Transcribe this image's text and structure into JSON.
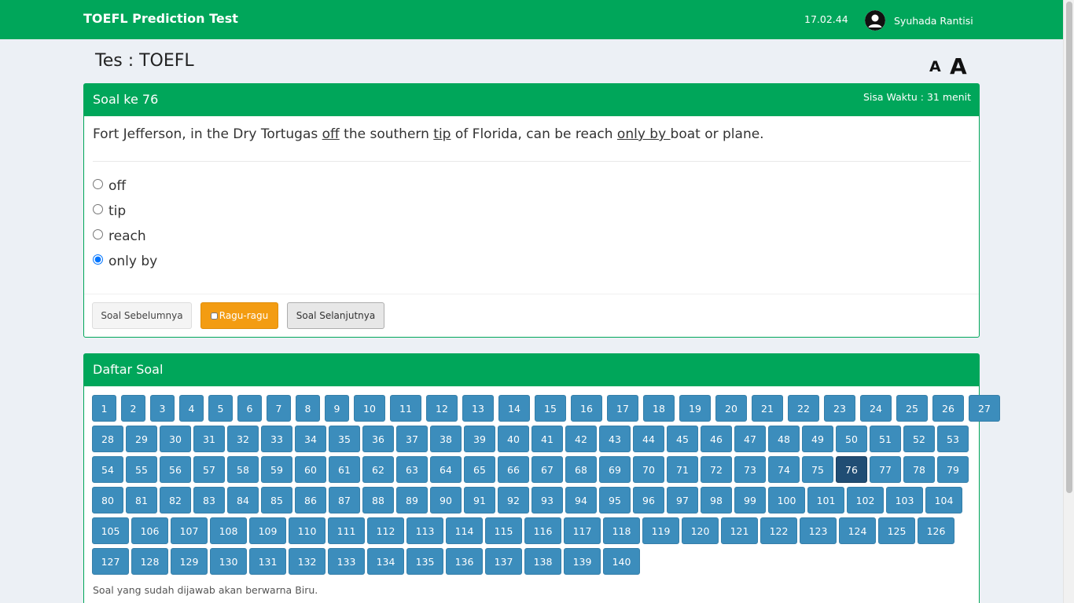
{
  "navbar": {
    "brand": "TOEFL Prediction Test",
    "clock": "17.02.44",
    "user_name": "Syuhada Rantisi"
  },
  "page": {
    "title": "Tes : TOEFL",
    "font_small_label": "A",
    "font_large_label": "A"
  },
  "question": {
    "header": "Soal ke 76",
    "timer": "Sisa Waktu : 31 menit",
    "segments": [
      {
        "text": "Fort Jefferson, in the Dry Tortugas ",
        "underline": false
      },
      {
        "text": "off",
        "underline": true
      },
      {
        "text": " the southern ",
        "underline": false
      },
      {
        "text": "tip",
        "underline": true
      },
      {
        "text": " of Florida, can be reach ",
        "underline": false
      },
      {
        "text": "only by ",
        "underline": true
      },
      {
        "text": "boat or plane.",
        "underline": false
      }
    ],
    "options": [
      {
        "label": "off",
        "selected": false
      },
      {
        "label": "tip",
        "selected": false
      },
      {
        "label": "reach",
        "selected": false
      },
      {
        "label": "only by",
        "selected": true
      }
    ],
    "buttons": {
      "prev": "Soal Sebelumnya",
      "doubt": "Ragu-ragu",
      "next": "Soal Selanjutnya"
    }
  },
  "question_list": {
    "header": "Daftar Soal",
    "total": 140,
    "current": 76,
    "note": "Soal yang sudah dijawab akan berwarna Biru."
  },
  "colors": {
    "header_green": "#00a65a",
    "answered_blue": "#3c8dbc",
    "current_blue": "#204d74",
    "doubt_orange": "#f39c12"
  }
}
